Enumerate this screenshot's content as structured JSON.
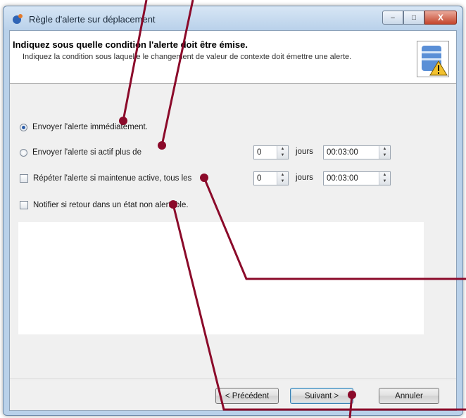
{
  "window": {
    "title": "Règle d'alerte sur déplacement",
    "controls": {
      "minimize": "–",
      "maximize": "□",
      "close": "X"
    }
  },
  "header": {
    "title": "Indiquez sous quelle condition l'alerte doit être émise.",
    "subtitle": "Indiquez la condition sous laquelle le changement de valeur de contexte doit émettre une alerte.",
    "icon": "database-warning-icon"
  },
  "options": {
    "immediate": {
      "label": "Envoyer l'alerte immédiatement.",
      "checked": true
    },
    "if_active": {
      "label": "Envoyer l'alerte si actif plus de",
      "checked": false,
      "days": "0",
      "days_unit": "jours",
      "time": "00:03:00"
    },
    "repeat": {
      "label": "Répéter l'alerte si maintenue active, tous les",
      "checked": false,
      "days": "0",
      "days_unit": "jours",
      "time": "00:03:00"
    },
    "notify_return": {
      "label": "Notifier si retour dans un état non alertable.",
      "checked": false
    }
  },
  "buttons": {
    "previous": "< Précédent",
    "next": "Suivant >",
    "cancel": "Annuler"
  },
  "annotation_color": "#8b0a2a"
}
